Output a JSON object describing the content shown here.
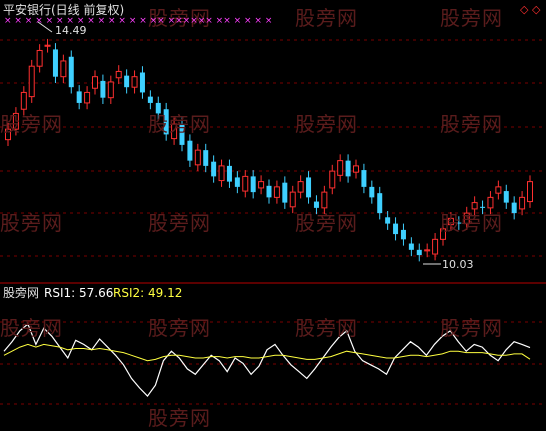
{
  "header": {
    "title": "平安银行(日线 前复权)",
    "title_color": "#e0e0e0"
  },
  "price_panel": {
    "high_label": "14.49",
    "low_label": "10.03",
    "marker_row": "× × × ×   × ×  ×  ×  ×   ×  ×  × × ×  ×× ×××××× ×× ×   ×  ×     ×",
    "marker_color": "#ff40ff",
    "up_color": "#ff3030",
    "down_color": "#3fd0ff",
    "right_icon": "diamond-icon"
  },
  "rsi_panel": {
    "name": "股旁网",
    "rsi1_label": "RSI1: 57.66",
    "rsi2_label": "RSI2: 49.12",
    "rsi1_color": "#ffffff",
    "rsi2_color": "#ffff40"
  },
  "watermarks": [
    "股旁网",
    "股旁网",
    "股旁网",
    "股旁网",
    "股旁网",
    "股旁网",
    "股旁网",
    "股旁网",
    "股旁网",
    "股旁网",
    "股旁网",
    "股旁网",
    "股旁网",
    "股旁网",
    "股旁网",
    "股旁网"
  ],
  "grid_color": "#7a0000",
  "chart_data": [
    {
      "type": "candlestick",
      "title": "平安银行(日线 前复权)",
      "annotations": [
        "14.49",
        "10.03"
      ],
      "ylim": [
        10.03,
        14.49
      ],
      "series": [
        {
          "name": "close",
          "values": [
            12.6,
            12.9,
            13.3,
            13.8,
            14.1,
            14.2,
            13.6,
            13.9,
            13.4,
            13.1,
            13.3,
            13.6,
            13.2,
            13.5,
            13.7,
            13.4,
            13.6,
            13.3,
            13.1,
            12.9,
            12.5,
            12.7,
            12.3,
            12.0,
            12.2,
            11.9,
            11.7,
            11.9,
            11.6,
            11.5,
            11.7,
            11.4,
            11.6,
            11.3,
            11.5,
            11.2,
            11.4,
            11.6,
            11.3,
            11.1,
            11.4,
            11.8,
            12.0,
            11.7,
            11.9,
            11.5,
            11.3,
            11.0,
            10.8,
            10.6,
            10.5,
            10.3,
            10.2,
            10.3,
            10.5,
            10.7,
            10.9,
            10.8,
            11.0,
            11.2,
            11.1,
            11.3,
            11.5,
            11.2,
            11.0,
            11.3,
            11.6
          ]
        }
      ]
    },
    {
      "type": "line",
      "title": "RSI",
      "ylim": [
        0,
        100
      ],
      "series": [
        {
          "name": "RSI1",
          "values": [
            55,
            62,
            70,
            75,
            60,
            72,
            66,
            58,
            50,
            63,
            60,
            56,
            64,
            58,
            52,
            45,
            35,
            28,
            22,
            30,
            48,
            55,
            50,
            42,
            38,
            45,
            52,
            48,
            40,
            50,
            46,
            38,
            44,
            56,
            60,
            52,
            45,
            40,
            35,
            42,
            50,
            58,
            65,
            70,
            55,
            48,
            45,
            42,
            38,
            50,
            56,
            62,
            58,
            52,
            60,
            66,
            70,
            62,
            55,
            60,
            58,
            52,
            48,
            56,
            62,
            60,
            57.66
          ]
        },
        {
          "name": "RSI2",
          "values": [
            52,
            55,
            58,
            60,
            58,
            60,
            59,
            58,
            56,
            57,
            57,
            56,
            57,
            56,
            55,
            54,
            52,
            50,
            48,
            49,
            51,
            52,
            52,
            51,
            50,
            50,
            51,
            51,
            50,
            51,
            51,
            50,
            50,
            51,
            52,
            52,
            51,
            50,
            49,
            49,
            50,
            51,
            53,
            55,
            54,
            53,
            52,
            51,
            50,
            50,
            51,
            52,
            52,
            51,
            52,
            53,
            55,
            55,
            54,
            54,
            54,
            53,
            52,
            52,
            53,
            53,
            49.12
          ]
        }
      ]
    }
  ]
}
